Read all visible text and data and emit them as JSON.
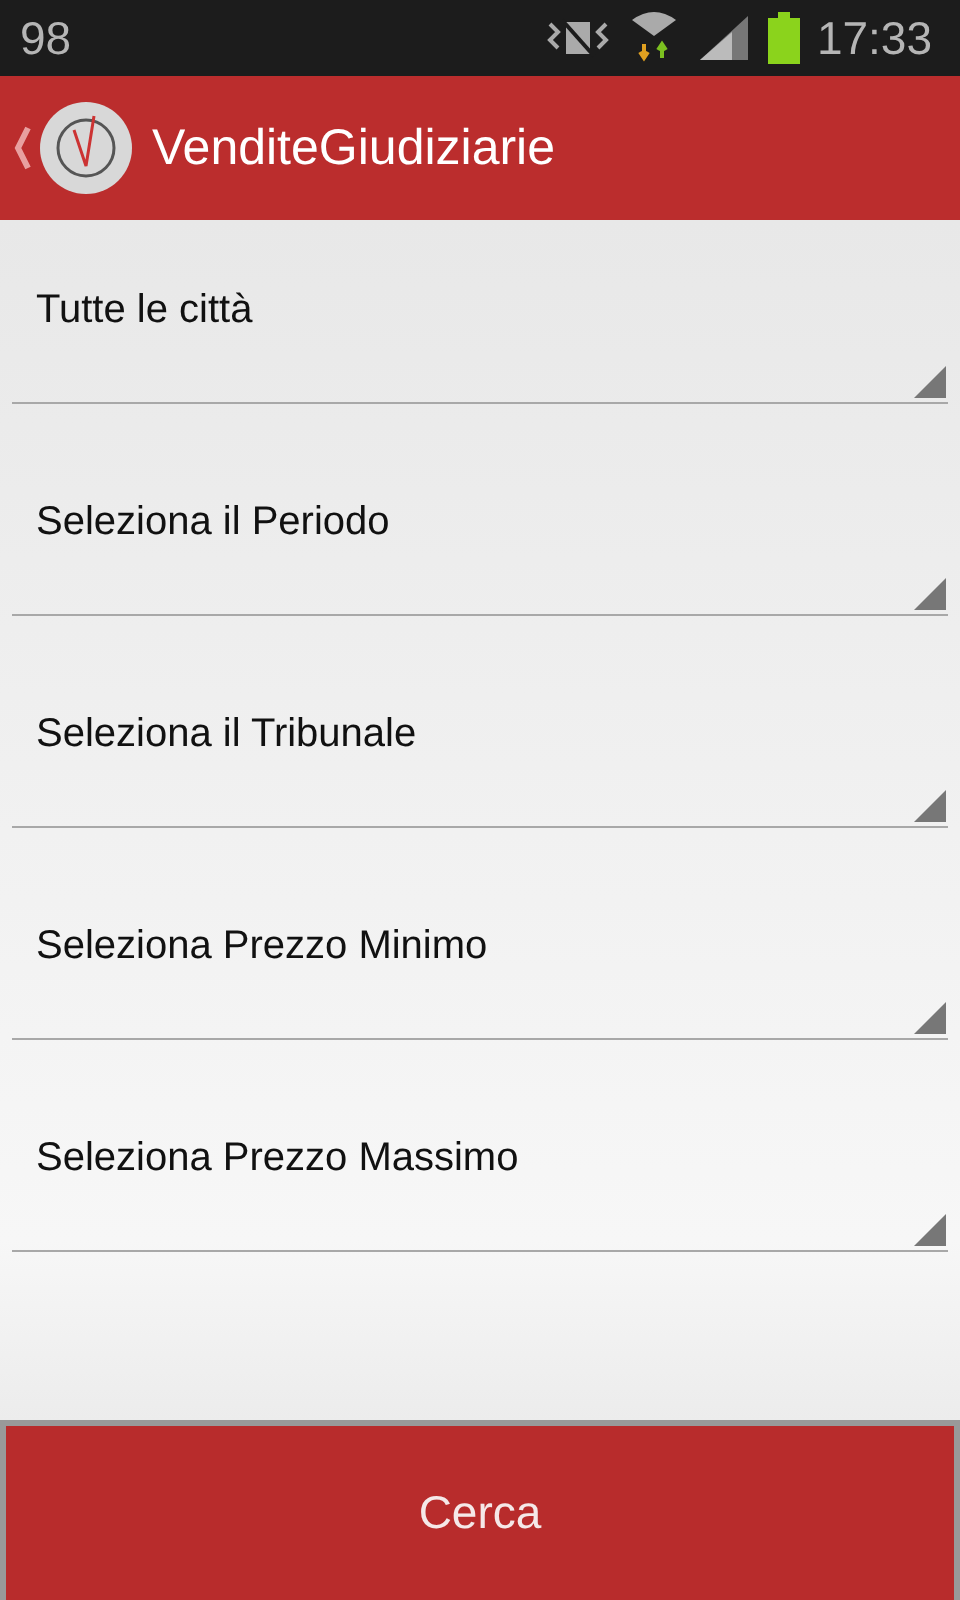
{
  "status_bar": {
    "notification": "98",
    "time": "17:33"
  },
  "app_bar": {
    "title": "VenditeGiudiziarie"
  },
  "spinners": [
    {
      "value": "Tutte le città"
    },
    {
      "value": "Seleziona il Periodo"
    },
    {
      "value": "Seleziona il Tribunale"
    },
    {
      "value": "Seleziona Prezzo Minimo"
    },
    {
      "value": "Seleziona Prezzo Massimo"
    }
  ],
  "search_button": {
    "label": "Cerca"
  }
}
